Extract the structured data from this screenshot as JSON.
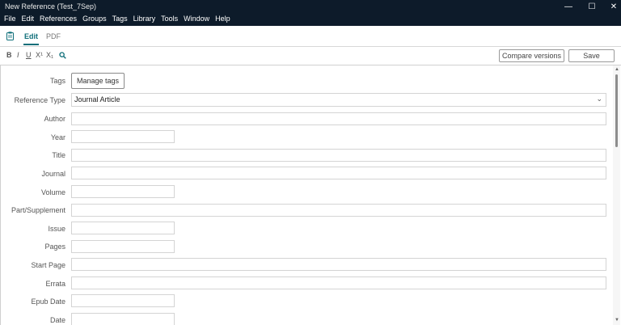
{
  "window": {
    "title": "New Reference (Test_7Sep)",
    "controls": {
      "minimize": "—",
      "maximize": "☐",
      "close": "✕"
    }
  },
  "menu": [
    "File",
    "Edit",
    "References",
    "Groups",
    "Tags",
    "Library",
    "Tools",
    "Window",
    "Help"
  ],
  "tabs": {
    "edit": "Edit",
    "pdf": "PDF"
  },
  "toolbar": {
    "bold": "B",
    "italic": "I",
    "underline": "U",
    "superscript": "X¹",
    "subscript": "X₁",
    "compare_versions": "Compare versions",
    "save": "Save"
  },
  "form": {
    "tags_label": "Tags",
    "manage_tags": "Manage tags",
    "reference_type_label": "Reference Type",
    "reference_type_value": "Journal Article",
    "fields": [
      "Author",
      "Year",
      "Title",
      "Journal",
      "Volume",
      "Part/Supplement",
      "Issue",
      "Pages",
      "Start Page",
      "Errata",
      "Epub Date",
      "Date"
    ]
  },
  "colors": {
    "titlebar": "#0d1b2a",
    "accent": "#0f6f7a"
  }
}
